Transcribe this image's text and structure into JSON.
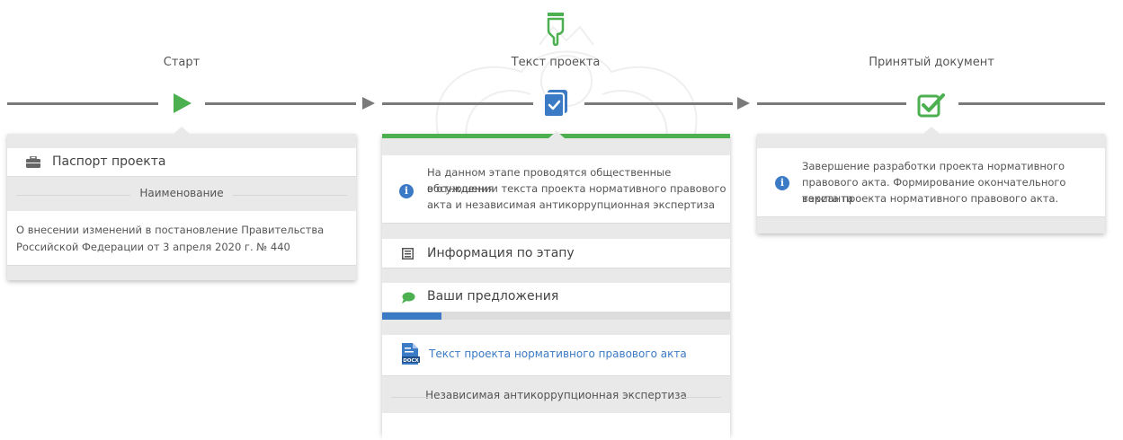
{
  "stages": {
    "start_title": "Старт",
    "text_title": "Текст проекта",
    "accepted_title": "Принятый документ"
  },
  "colors": {
    "accent_green": "#4caf50",
    "accent_blue": "#3b7ac4",
    "line_gray": "#7a7a7a"
  },
  "start_card": {
    "passport_label": "Паспорт проекта",
    "name_header": "Наименование",
    "name_line1": "О внесении изменений в постановление Правительства",
    "name_line2": "Российской Федерации от 3 апреля 2020 г. № 440"
  },
  "text_card": {
    "info_line1": "На данном этапе проводятся общественные обсуждения",
    "info_line2": "в отношении текста проекта нормативного правового",
    "info_line3": "акта и независимая антикоррупционная экспертиза",
    "stage_info_label": "Информация по этапу",
    "proposals_label": "Ваши предложения",
    "proposals_progress": 0.17,
    "doc_link": "Текст проекта нормативного правового акта",
    "anticorruption_header": "Независимая антикоррупционная экспертиза"
  },
  "accepted_card": {
    "line1": "Завершение разработки проекта нормативного",
    "line2": "правового акта. Формирование окончательного варианта",
    "line3": "текста проекта нормативного правового акта."
  }
}
